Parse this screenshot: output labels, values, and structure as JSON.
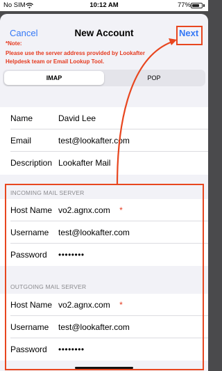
{
  "status_bar": {
    "carrier": "No SIM",
    "time": "10:12 AM",
    "battery_percent": "77%",
    "battery_level": 0.77,
    "wifi_icon": "wifi-icon"
  },
  "nav": {
    "cancel": "Cancel",
    "title": "New Account",
    "next": "Next"
  },
  "note": {
    "title": "*Note:",
    "text": "Please use the server address provided by Lookafter Helpdesk team or Email Lookup Tool."
  },
  "segments": [
    {
      "label": "IMAP",
      "selected": true
    },
    {
      "label": "POP",
      "selected": false
    }
  ],
  "account": {
    "name_label": "Name",
    "name_value": "David Lee",
    "email_label": "Email",
    "email_value": "test@lookafter.com",
    "description_label": "Description",
    "description_value": "Lookafter Mail"
  },
  "incoming": {
    "header": "INCOMING MAIL SERVER",
    "host_label": "Host Name",
    "host_value": "vo2.agnx.com",
    "required_mark": "*",
    "username_label": "Username",
    "username_value": "test@lookafter.com",
    "password_label": "Password",
    "password_value": "••••••••"
  },
  "outgoing": {
    "header": "OUTGOING MAIL SERVER",
    "host_label": "Host Name",
    "host_value": "vo2.agnx.com",
    "required_mark": "*",
    "username_label": "Username",
    "username_value": "test@lookafter.com",
    "password_label": "Password",
    "password_value": "••••••••"
  },
  "colors": {
    "accent": "#3478f6",
    "annotation": "#e8461f",
    "note": "#e53a1f",
    "background": "#f2f2f7"
  }
}
